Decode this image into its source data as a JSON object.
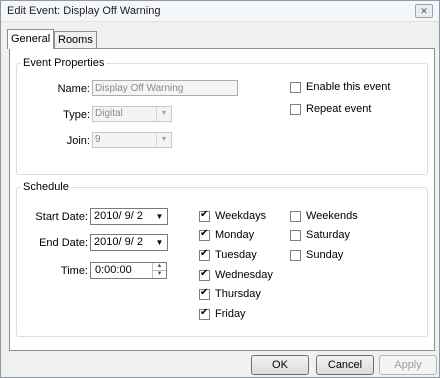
{
  "window": {
    "title": "Edit Event: Display Off Warning"
  },
  "tabs": [
    {
      "label": "General"
    },
    {
      "label": "Rooms"
    }
  ],
  "event_properties": {
    "legend": "Event Properties",
    "name_label": "Name:",
    "name_value": "Display Off Warning",
    "type_label": "Type:",
    "type_value": "Digital",
    "join_label": "Join:",
    "join_value": "9",
    "enable_label": "Enable this event",
    "enable_checked": false,
    "repeat_label": "Repeat event",
    "repeat_checked": false
  },
  "schedule": {
    "legend": "Schedule",
    "start_label": "Start Date:",
    "start_value": "2010/ 9/ 2",
    "end_label": "End Date:",
    "end_value": "2010/ 9/ 2",
    "time_label": "Time:",
    "time_value": "0:00:00",
    "days": [
      {
        "label": "Weekdays",
        "checked": true
      },
      {
        "label": "Monday",
        "checked": true
      },
      {
        "label": "Tuesday",
        "checked": true
      },
      {
        "label": "Wednesday",
        "checked": true
      },
      {
        "label": "Thursday",
        "checked": true
      },
      {
        "label": "Friday",
        "checked": true
      }
    ],
    "weekend_days": [
      {
        "label": "Weekends",
        "checked": false
      },
      {
        "label": "Saturday",
        "checked": false
      },
      {
        "label": "Sunday",
        "checked": false
      }
    ]
  },
  "buttons": {
    "ok": "OK",
    "cancel": "Cancel",
    "apply": "Apply"
  },
  "icons": {
    "close": "close-icon",
    "dropdown": "chevron-down-icon",
    "spinner": "spinner-arrows-icon"
  }
}
